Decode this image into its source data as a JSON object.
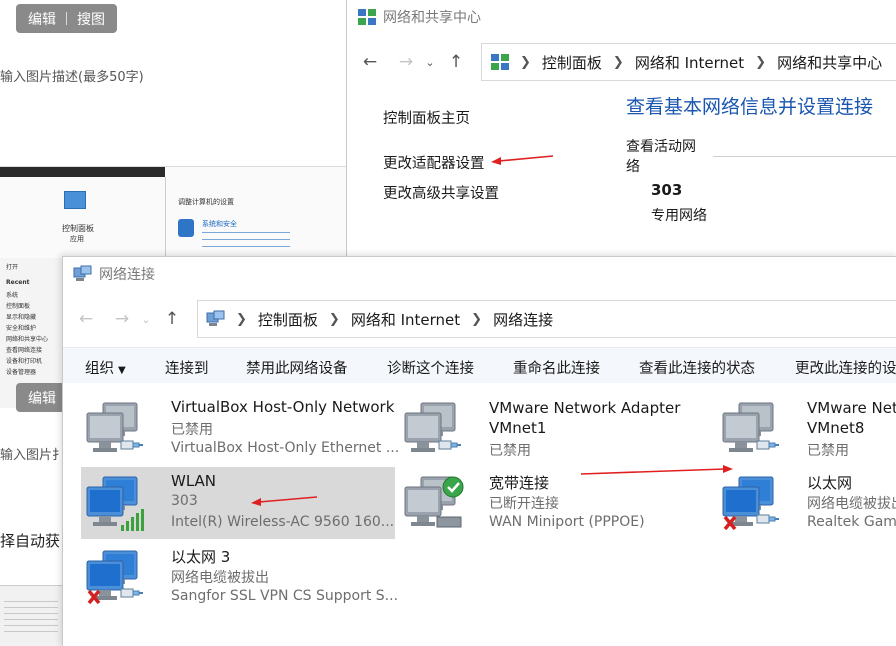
{
  "background": {
    "edit_pill_top": {
      "edit": "编辑",
      "image_search": "搜图"
    },
    "edit_pill_mid": {
      "edit": "编辑"
    },
    "desc_placeholder_1": "输入图片描述(最多50字)",
    "desc_placeholder_2": "输入图片扌",
    "partial_text": "择自动获",
    "thumb": {
      "control_panel": "控制面板",
      "control_panel_sub": "应用",
      "recent": "Recent",
      "adjust_settings": "调整计算机的设置",
      "system_security": "系统和安全",
      "sidebar_items": [
        "打开",
        "Recent",
        "系统",
        "控制面板",
        "显示和隐藏",
        "安全和维护",
        "网络和共享中心",
        "查看网络连接",
        "设备和打印机",
        "设备管理器"
      ]
    }
  },
  "nsc": {
    "title": "网络和共享中心",
    "breadcrumb": [
      "控制面板",
      "网络和 Internet",
      "网络和共享中心"
    ],
    "links": [
      "控制面板主页",
      "更改适配器设置",
      "更改高级共享设置"
    ],
    "heading": "查看基本网络信息并设置连接",
    "active_networks_label": "查看活动网络",
    "network_name": "303",
    "network_type": "专用网络"
  },
  "nc": {
    "title": "网络连接",
    "breadcrumb": [
      "控制面板",
      "网络和 Internet",
      "网络连接"
    ],
    "commands": [
      "组织",
      "连接到",
      "禁用此网络设备",
      "诊断这个连接",
      "重命名此连接",
      "查看此连接的状态",
      "更改此连接的设"
    ],
    "items": [
      {
        "name": "VirtualBox Host-Only Network",
        "status": "已禁用",
        "device": "VirtualBox Host-Only Ethernet ..."
      },
      {
        "name": "VMware Network Adapter",
        "name2": "VMnet1",
        "status": "已禁用"
      },
      {
        "name": "VMware Netwo",
        "name2": "VMnet8",
        "status": "已禁用"
      },
      {
        "name": "WLAN",
        "status": "303",
        "device": "Intel(R) Wireless-AC 9560 160..."
      },
      {
        "name": "宽带连接",
        "status": "已断开连接",
        "device": "WAN Miniport (PPPOE)"
      },
      {
        "name": "以太网",
        "status": "网络电缆被拔出",
        "device": "Realtek Gaming"
      },
      {
        "name": "以太网 3",
        "status": "网络电缆被拔出",
        "device": "Sangfor SSL VPN CS Support S..."
      }
    ]
  },
  "icons": {
    "back": "back-arrow-icon",
    "forward": "forward-arrow-icon",
    "recent": "chevron-down-icon",
    "up": "up-arrow-icon",
    "network_adapter": "network-adapter-icon",
    "annotation": "red-arrow"
  },
  "colors": {
    "link": "#1a56b0",
    "annotation_arrow": "#e02020",
    "selected_row": "#d9d9d9",
    "disabled_text": "#6d6d6d"
  }
}
